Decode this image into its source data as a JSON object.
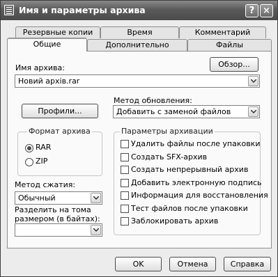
{
  "window": {
    "title": "Имя и параметры архива",
    "help_button": "?",
    "close_button": "×"
  },
  "tabs_back": [
    "Резервные копии",
    "Время",
    "Комментарий"
  ],
  "tabs_front": [
    "Общие",
    "Дополнительно",
    "Файлы"
  ],
  "active_tab": "Общие",
  "archive_name": {
    "label": "Имя архива:",
    "value": "Новий архів.rar",
    "browse_button": "Обзор..."
  },
  "update_method": {
    "label": "Метод обновления:",
    "value": "Добавить с заменой файлов"
  },
  "profiles_button": "Профили...",
  "archive_format": {
    "title": "Формат архива",
    "options": [
      "RAR",
      "ZIP"
    ],
    "selected": "RAR"
  },
  "compression": {
    "label": "Метод сжатия:",
    "value": "Обычный"
  },
  "split": {
    "label_line1": "Разделить на тома",
    "label_line2": "размером (в байтах):",
    "value": ""
  },
  "archive_options": {
    "title": "Параметры архивации",
    "items": [
      {
        "label": "Удалить файлы после упаковки",
        "checked": false
      },
      {
        "label": "Создать SFX-архив",
        "checked": false
      },
      {
        "label": "Создать непрерывный архив",
        "checked": false
      },
      {
        "label": "Добавить электронную подпись",
        "checked": false
      },
      {
        "label": "Информация для восстановления",
        "checked": false
      },
      {
        "label": "Тест файлов после упаковки",
        "checked": false
      },
      {
        "label": "Заблокировать архив",
        "checked": false
      }
    ]
  },
  "footer": {
    "ok": "OK",
    "cancel": "Отмена",
    "help": "Справка"
  }
}
